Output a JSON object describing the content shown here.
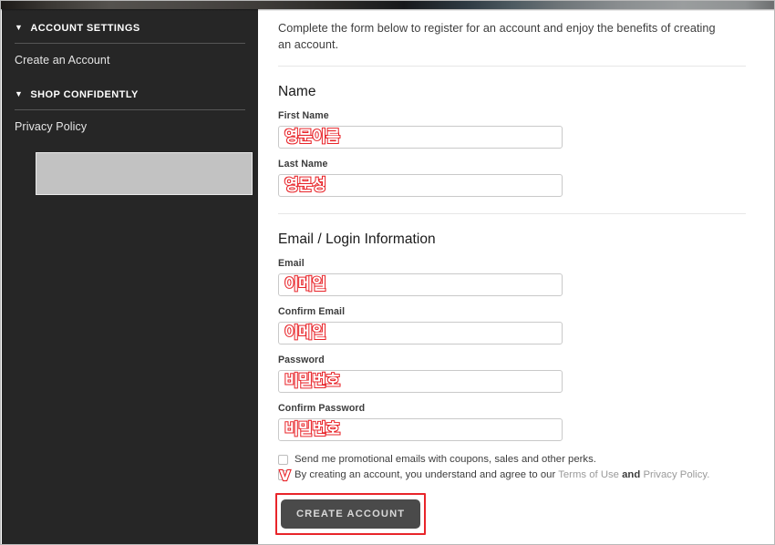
{
  "sidebar": {
    "sections": [
      {
        "caret_icon": "▼",
        "heading": "ACCOUNT SETTINGS",
        "links": [
          {
            "label": "Create an Account"
          }
        ]
      },
      {
        "caret_icon": "▼",
        "heading": "SHOP CONFIDENTLY",
        "links": [
          {
            "label": "Privacy Policy"
          }
        ]
      }
    ]
  },
  "main": {
    "intro": "Complete the form below to register for an account and enjoy the benefits of creating an account.",
    "name_section": {
      "title": "Name",
      "fields": [
        {
          "label": "First Name",
          "value": "영문이름"
        },
        {
          "label": "Last Name",
          "value": "영문성"
        }
      ]
    },
    "login_section": {
      "title": "Email / Login Information",
      "fields": [
        {
          "label": "Email",
          "value": "이메일"
        },
        {
          "label": "Confirm Email",
          "value": "이메일"
        },
        {
          "label": "Password",
          "value": "비밀번호"
        },
        {
          "label": "Confirm Password",
          "value": "비밀번호"
        }
      ]
    },
    "checkboxes": {
      "promo": {
        "label": "Send me promotional emails with coupons, sales and other perks.",
        "checked": false
      },
      "terms": {
        "prefix": "By creating an account, you understand and agree to our ",
        "link1": "Terms of Use",
        "middle": " and ",
        "link2": "Privacy Policy",
        "suffix": ".",
        "checked": false,
        "annotation_mark": "V"
      }
    },
    "submit_label": "CREATE ACCOUNT"
  },
  "colors": {
    "annotation_red": "#e8252a",
    "sidebar_bg": "#262626",
    "button_bg": "#4a4a4a",
    "link_gray": "#9a9a9a"
  }
}
